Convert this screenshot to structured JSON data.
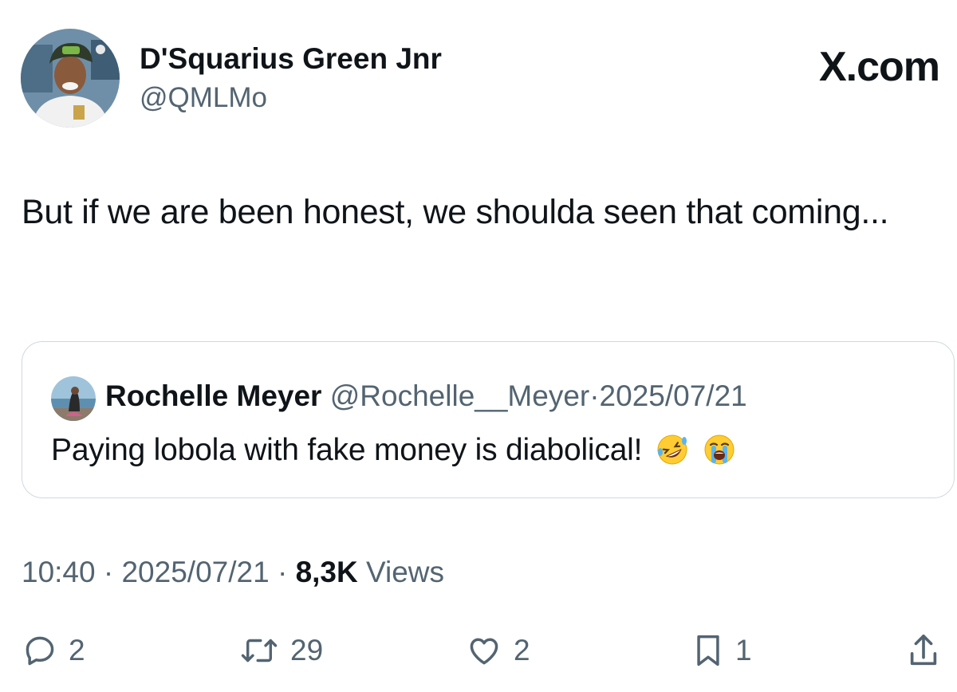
{
  "author": {
    "name": "D'Squarius Green Jnr",
    "handle": "@QMLMo"
  },
  "brand": "X.com",
  "tweet": {
    "text": "But if we are been honest, we shoulda seen that coming..."
  },
  "quote": {
    "name": "Rochelle Meyer",
    "handle": "@Rochelle__Meyer",
    "separator": "·",
    "date": "2025/07/21",
    "text": "Paying lobola with fake money is diabolical!",
    "emojis": [
      "rolling-on-floor-laughing-emoji",
      "loudly-crying-emoji"
    ]
  },
  "meta": {
    "time": "10:40",
    "separator": "·",
    "date": "2025/07/21",
    "views_count": "8,3K",
    "views_label": "Views"
  },
  "actions": {
    "replies": {
      "icon": "reply-icon",
      "count": "2"
    },
    "reposts": {
      "icon": "repost-icon",
      "count": "29"
    },
    "likes": {
      "icon": "heart-icon",
      "count": "2"
    },
    "bookmarks": {
      "icon": "bookmark-icon",
      "count": "1"
    },
    "share": {
      "icon": "share-icon"
    }
  },
  "colors": {
    "text": "#0f1419",
    "secondary": "#536471",
    "border": "#cfd9de"
  }
}
